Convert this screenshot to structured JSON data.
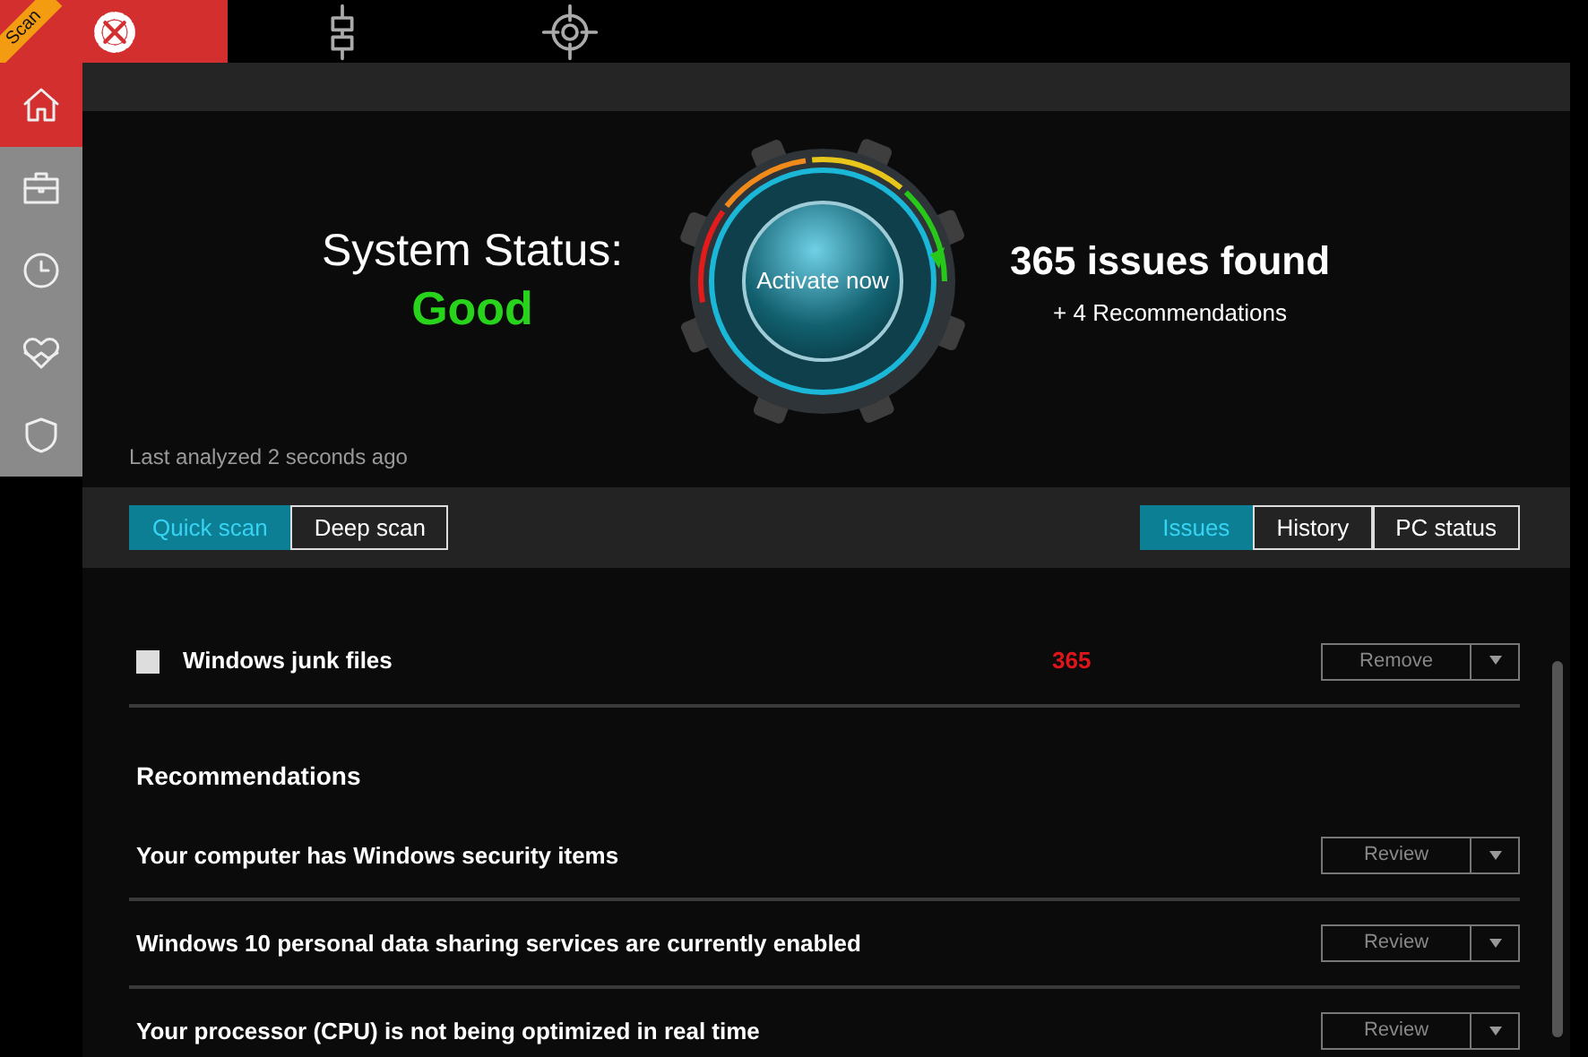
{
  "top_tabs": [
    {
      "kind": "tools",
      "selected": true,
      "ribbon": "Scan"
    },
    {
      "kind": "network",
      "selected": false
    },
    {
      "kind": "target",
      "selected": false
    }
  ],
  "sidebar": {
    "items": [
      {
        "kind": "home",
        "selected": true
      },
      {
        "kind": "briefcase",
        "selected": false
      },
      {
        "kind": "clock",
        "selected": false
      },
      {
        "kind": "heart",
        "selected": false
      },
      {
        "kind": "shield",
        "selected": false
      }
    ]
  },
  "status": {
    "label": "System Status:",
    "value": "Good",
    "last_analyzed": "Last analyzed 2 seconds ago",
    "activate_button": "Activate now",
    "issues_title": "365 issues found",
    "recommendations_summary": "+ 4 Recommendations"
  },
  "scan_modes": [
    {
      "label": "Quick scan",
      "selected": true
    },
    {
      "label": "Deep scan",
      "selected": false
    }
  ],
  "views": [
    {
      "label": "Issues",
      "selected": true
    },
    {
      "label": "History",
      "selected": false
    },
    {
      "label": "PC status",
      "selected": false
    }
  ],
  "issues": [
    {
      "label": "Windows junk files",
      "checked": false,
      "count": "365",
      "action": "Remove"
    }
  ],
  "recommendations": {
    "title": "Recommendations",
    "items": [
      {
        "text": "Your computer has Windows security items",
        "action": "Review"
      },
      {
        "text": "Windows 10 personal data sharing services are currently enabled",
        "action": "Review"
      },
      {
        "text": "Your processor (CPU) is not being optimized in real time",
        "action": "Review"
      }
    ]
  }
}
